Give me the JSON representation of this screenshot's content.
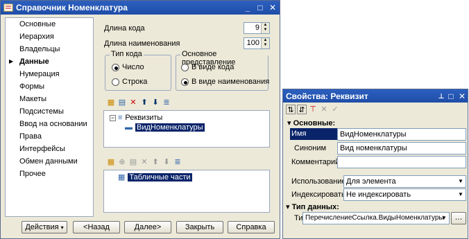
{
  "main_window": {
    "title": "Справочник Номенклатура",
    "sidebar": [
      "Основные",
      "Иерархия",
      "Владельцы",
      "Данные",
      "Нумерация",
      "Формы",
      "Макеты",
      "Подсистемы",
      "Ввод на основании",
      "Права",
      "Интерфейсы",
      "Обмен данными",
      "Прочее"
    ],
    "active_index": 3,
    "code_length_label": "Длина кода",
    "code_length_value": "9",
    "name_length_label": "Длина наименования",
    "name_length_value": "100",
    "code_type_group": "Тип кода",
    "code_type_number": "Число",
    "code_type_string": "Строка",
    "main_repr_group": "Основное представление",
    "repr_code": "В виде кода",
    "repr_name": "В виде наименования",
    "tree_root": "Реквизиты",
    "tree_child": "ВидНоменклатуры",
    "tabular_root": "Табличные части",
    "btn_actions": "Действия",
    "btn_back": "<Назад",
    "btn_next": "Далее>",
    "btn_close": "Закрыть",
    "btn_help": "Справка"
  },
  "props_window": {
    "title": "Свойства: Реквизит",
    "section_basic": "Основные:",
    "name_label": "Имя",
    "name_value": "ВидНоменклатуры",
    "synonym_label": "Синоним",
    "synonym_value": "Вид номенклатуры",
    "comment_label": "Комментарий",
    "comment_value": "",
    "usage_label": "Использование",
    "usage_value": "Для элемента",
    "index_label": "Индексировать",
    "index_value": "Не индексировать",
    "section_datatype": "Тип данных:",
    "type_label": "Тип",
    "type_value": "ПеречислениеСсылка.ВидыНоменклатуры"
  }
}
